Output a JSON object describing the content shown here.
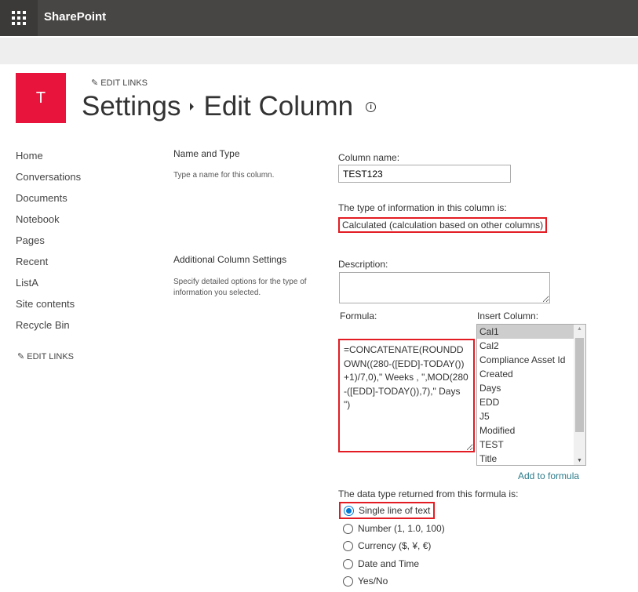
{
  "header": {
    "app_name": "SharePoint"
  },
  "site": {
    "logo_letter": "T",
    "edit_links": "EDIT LINKS"
  },
  "title": {
    "parent": "Settings",
    "current": "Edit Column",
    "info_icon": "i"
  },
  "nav": {
    "items": [
      "Home",
      "Conversations",
      "Documents",
      "Notebook",
      "Pages",
      "Recent",
      "ListA",
      "Site contents",
      "Recycle Bin"
    ],
    "edit_links": "EDIT LINKS"
  },
  "sections": {
    "name_type": {
      "heading": "Name and Type",
      "desc": "Type a name for this column."
    },
    "additional": {
      "heading": "Additional Column Settings",
      "desc": "Specify detailed options for the type of information you selected."
    }
  },
  "form": {
    "column_name_label": "Column name:",
    "column_name_value": "TEST123",
    "type_label": "The type of information in this column is:",
    "type_value": "Calculated (calculation based on other columns)",
    "description_label": "Description:",
    "description_value": "",
    "formula_label": "Formula:",
    "formula_value": "=CONCATENATE(ROUNDDOWN((280-([EDD]-TODAY())+1)/7,0),\" Weeks , \",MOD(280-([EDD]-TODAY()),7),\" Days \")",
    "insert_column_label": "Insert Column:",
    "columns": [
      "Cal1",
      "Cal2",
      "Compliance Asset Id",
      "Created",
      "Days",
      "EDD",
      "J5",
      "Modified",
      "TEST",
      "Title"
    ],
    "selected_column": "Cal1",
    "add_to_formula": "Add to formula",
    "return_type_label": "The data type returned from this formula is:",
    "return_types": [
      "Single line of text",
      "Number (1, 1.0, 100)",
      "Currency ($, ¥, €)",
      "Date and Time",
      "Yes/No"
    ],
    "selected_return_type": "Single line of text"
  },
  "colors": {
    "topbar": "#484644",
    "logo": "#e8143c",
    "highlight": "#e31c23",
    "link": "#2b7a8a",
    "radio": "#0078d4"
  }
}
